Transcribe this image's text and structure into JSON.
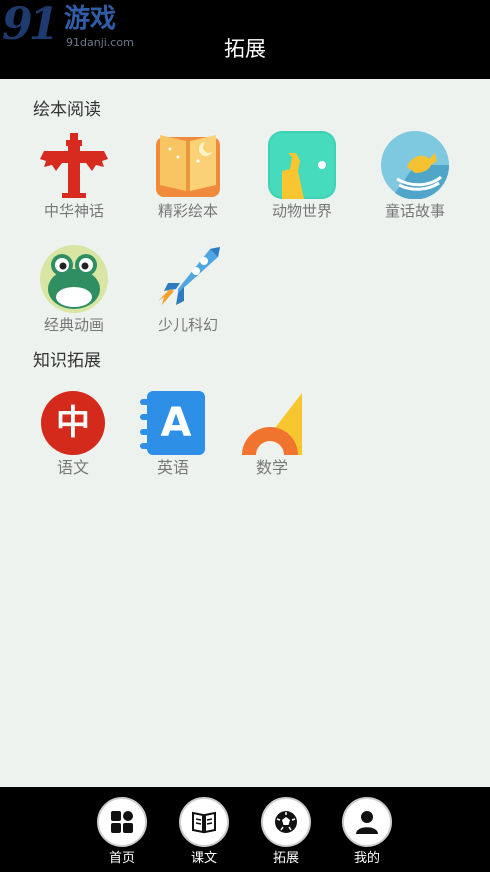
{
  "watermark": {
    "number": "91",
    "title": "游戏",
    "subtitle": "91danji.com"
  },
  "header": {
    "title": "拓展"
  },
  "sections": [
    {
      "title": "绘本阅读",
      "items": [
        {
          "label": "中华神话",
          "icon": "pillar-icon"
        },
        {
          "label": "精彩绘本",
          "icon": "book-icon"
        },
        {
          "label": "动物世界",
          "icon": "giraffe-icon"
        },
        {
          "label": "童话故事",
          "icon": "rocking-horse-icon"
        },
        {
          "label": "经典动画",
          "icon": "frog-icon"
        },
        {
          "label": "少儿科幻",
          "icon": "rocket-icon"
        }
      ]
    },
    {
      "title": "知识拓展",
      "items": [
        {
          "label": "语文",
          "icon": "chinese-char-icon",
          "glyph": "中"
        },
        {
          "label": "英语",
          "icon": "english-letter-icon",
          "glyph": "A"
        },
        {
          "label": "数学",
          "icon": "ruler-protractor-icon"
        }
      ]
    }
  ],
  "tabs": [
    {
      "label": "首页",
      "icon": "home-grid-icon"
    },
    {
      "label": "课文",
      "icon": "open-book-icon"
    },
    {
      "label": "拓展",
      "icon": "ball-icon"
    },
    {
      "label": "我的",
      "icon": "user-icon"
    }
  ],
  "colors": {
    "header_bg": "#000000",
    "page_bg": "#eef2ef",
    "tabbar_bg": "#000000"
  }
}
